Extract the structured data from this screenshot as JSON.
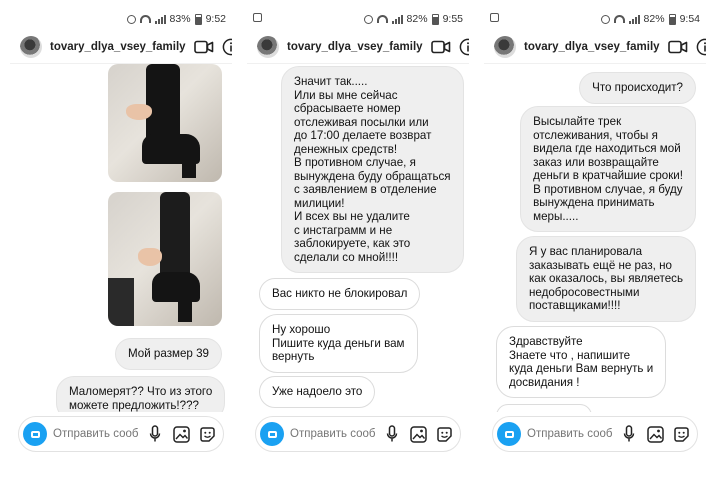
{
  "panels": [
    {
      "status": {
        "battery": "83%",
        "time": "9:52"
      },
      "username": "tovary_dlya_vsey_family",
      "messages": {
        "m1": "Мой размер 39",
        "m2": "Маломерят?? Что из этого\nможете предложить!???"
      },
      "input_placeholder": "Отправить сообщ..."
    },
    {
      "status": {
        "battery": "82%",
        "time": "9:55"
      },
      "username": "tovary_dlya_vsey_family",
      "messages": {
        "m1": "Значит так.....\nИли вы мне сейчас\nсбрасываете номер\nотслеживая посылки или\nдо 17:00 делаете возврат\nденежных средств!\nВ противном случае, я\nвынуждена буду обращаться\nс заявлением в отделение\nмилиции!\nИ всех вы не удалите\nс инстаграмм и не\nзаблокируете, как это\nсделали со мной!!!!",
        "m2": "Вас никто не блокировал",
        "m3": "Ну хорошо\nПишите куда деньги вам\nвернуть",
        "m4": "Уже надоело это"
      },
      "input_placeholder": "Отправить сообщ..."
    },
    {
      "status": {
        "battery": "82%",
        "time": "9:54"
      },
      "username": "tovary_dlya_vsey_family",
      "messages": {
        "m1": "Что происходит?",
        "m2": "Высылайте трек\nотслеживания, чтобы я\nвидела где находиться мой\nзаказ или возвращайте\nденьги в кратчайшие сроки!\nВ противном случае, я буду\nвынуждена принимать\nмеры.....",
        "m3": "Я у вас планировала\nзаказывать ещё не раз, но\nкак оказалось, вы являетесь\nнедобросовестными\nпоставщиками!!!!",
        "m4": "Здравствуйте\nЗнаете что , напишите\nкуда деньги Вам вернуть и\nдосвидания !"
      },
      "input_placeholder": "Отправить сообщ..."
    }
  ],
  "colors": {
    "camera_button": "#1aa1f2",
    "bubble_gray": "#efefef"
  },
  "icons": [
    "video-call-icon",
    "info-icon",
    "microphone-icon",
    "gallery-icon",
    "sticker-icon",
    "camera-icon"
  ]
}
